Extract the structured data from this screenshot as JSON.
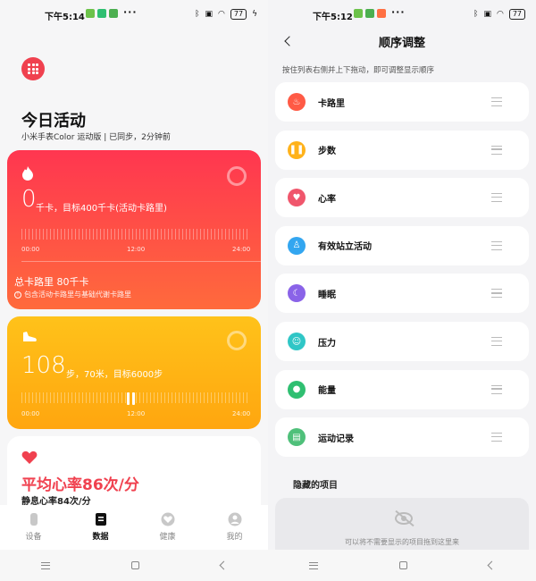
{
  "left": {
    "status": {
      "time": "下午5:14",
      "more": "···",
      "battery": "77"
    },
    "page_title": "今日活动",
    "device_line": "小米手表Color  运动版  |  已同步，2分钟前",
    "calories": {
      "value": "0",
      "desc": "千卡，目标400千卡(活动卡路里)",
      "ticks": [
        "00:00",
        "12:00",
        "24:00"
      ],
      "total": "总卡路里  80千卡",
      "note": "包含活动卡路里与基础代谢卡路里"
    },
    "steps": {
      "value": "108",
      "desc": "步，70米，目标6000步",
      "ticks": [
        "00:00",
        "12:00",
        "24:00"
      ]
    },
    "heart": {
      "title": "平均心率86次/分",
      "resting": "静息心率84次/分"
    },
    "nav": [
      {
        "label": "设备",
        "icon": "watch-icon"
      },
      {
        "label": "数据",
        "icon": "data-icon",
        "active": true
      },
      {
        "label": "健康",
        "icon": "health-icon"
      },
      {
        "label": "我的",
        "icon": "profile-icon"
      }
    ]
  },
  "right": {
    "status": {
      "time": "下午5:12",
      "more": "···",
      "battery": "77"
    },
    "title": "顺序调整",
    "hint": "按住列表右侧并上下拖动，即可调整显示顺序",
    "items": [
      {
        "label": "卡路里",
        "icon": "flame-icon",
        "color": "#ff5a45"
      },
      {
        "label": "步数",
        "icon": "footprints-icon",
        "color": "#ffb21a"
      },
      {
        "label": "心率",
        "icon": "heart-icon",
        "color": "#f0566c"
      },
      {
        "label": "有效站立活动",
        "icon": "standing-person-icon",
        "color": "#33a6f0"
      },
      {
        "label": "睡眠",
        "icon": "moon-icon",
        "color": "#8a63e8"
      },
      {
        "label": "压力",
        "icon": "smile-icon",
        "color": "#2fc6c6"
      },
      {
        "label": "能量",
        "icon": "chat-bubble-icon",
        "color": "#2fbf71"
      },
      {
        "label": "运动记录",
        "icon": "record-icon",
        "color": "#4fc07a"
      }
    ],
    "hidden_title": "隐藏的项目",
    "hidden_hint": "可以将不需要显示的项目拖到这里来"
  },
  "colors": {
    "accent": "#f0414f",
    "calorie_gradient": [
      "#ff3650",
      "#ff6a3c"
    ],
    "steps_gradient": [
      "#ffc21a",
      "#ffa60f"
    ]
  }
}
